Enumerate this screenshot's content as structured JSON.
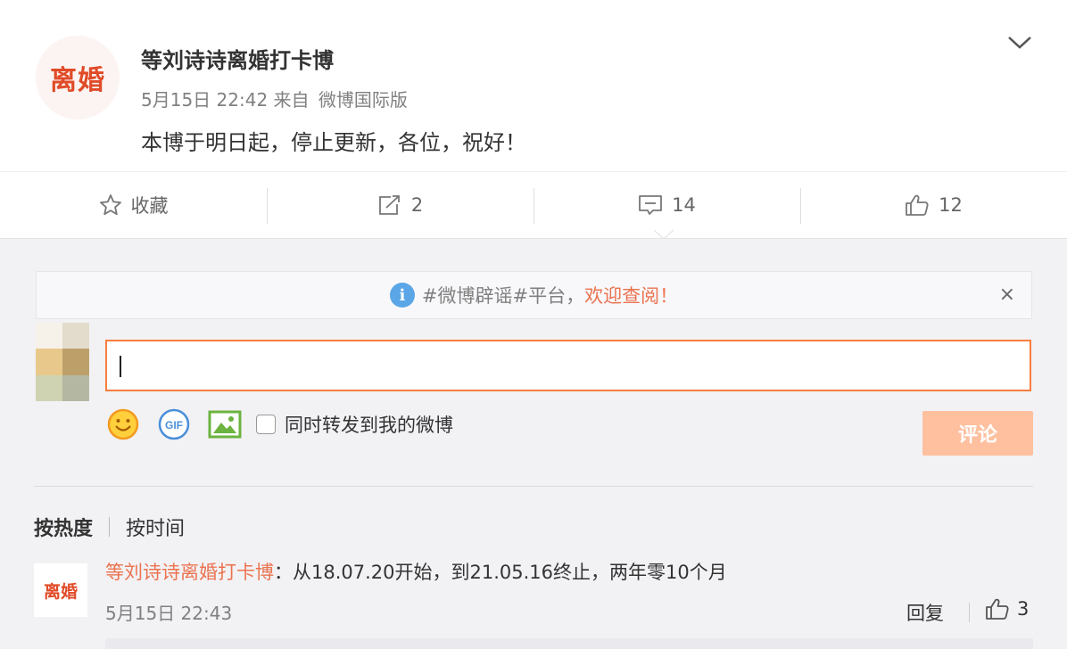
{
  "post": {
    "avatar_text": "离婚",
    "author": "等刘诗诗离婚打卡博",
    "time": "5月15日 22:42",
    "source_prefix": "来自",
    "source": "微博国际版",
    "content": "本博于明日起，停止更新，各位，祝好！"
  },
  "actions": {
    "favorite_label": "收藏",
    "repost_count": "2",
    "comment_count": "14",
    "like_count": "12"
  },
  "notice": {
    "info_glyph": "i",
    "topic": "#微博辟谣#平台，",
    "link": "欢迎查阅！",
    "close": "×"
  },
  "composer": {
    "sync_label": "同时转发到我的微博",
    "submit_label": "评论",
    "gif_label": "GIF"
  },
  "sort": {
    "by_hot": "按热度",
    "by_time": "按时间"
  },
  "comment": {
    "avatar_text": "离婚",
    "nick": "等刘诗诗离婚打卡博",
    "text": "：从18.07.20开始，到21.05.16终止，两年零10个月",
    "time": "5月15日 22:43",
    "reply_label": "回复",
    "like_count": "3"
  },
  "colors": {
    "accent": "#eb7350",
    "submit_disabled": "#ffc09f",
    "info_blue": "#5aa6e6"
  }
}
